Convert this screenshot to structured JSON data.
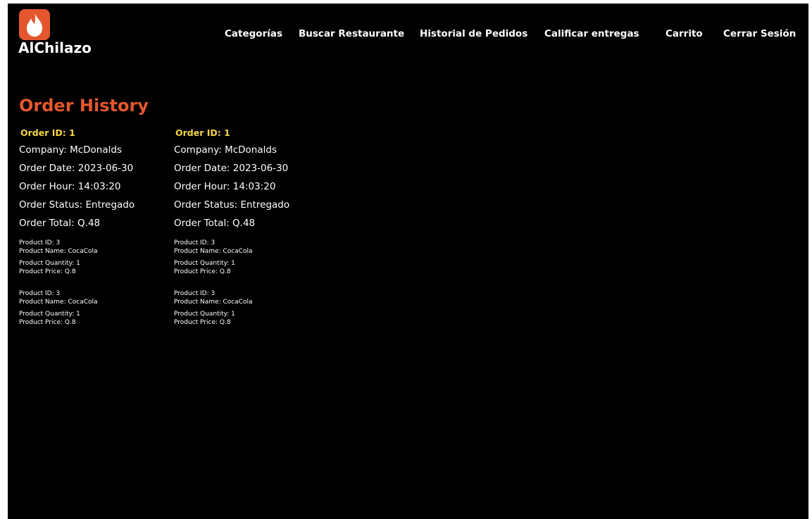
{
  "brand": {
    "name": "AlChilazo",
    "logo_icon": "flame-icon",
    "logo_color": "#e4572e"
  },
  "nav": {
    "items": [
      {
        "label": "Categorías"
      },
      {
        "label": "Buscar Restaurante"
      },
      {
        "label": "Historial de Pedidos"
      },
      {
        "label": "Calificar entregas"
      },
      {
        "label": "Carrito"
      },
      {
        "label": "Cerrar Sesión"
      }
    ]
  },
  "page": {
    "title": "Order History",
    "title_color": "#e4572e",
    "accent_color": "#f5d547"
  },
  "orders": [
    {
      "id": "Order ID: 1",
      "company": "Company: McDonalds",
      "date": "Order Date: 2023-06-30",
      "hour": "Order Hour: 14:03:20",
      "status": "Order Status: Entregado",
      "total": "Order Total: Q.48",
      "products": [
        {
          "id": "Product ID: 3",
          "name": "Product Name: CocaCola",
          "quantity": "Product Quantity: 1",
          "price": "Product Price: Q.8"
        },
        {
          "id": "Product ID: 3",
          "name": "Product Name: CocaCola",
          "quantity": "Product Quantity: 1",
          "price": "Product Price: Q.8"
        }
      ]
    },
    {
      "id": "Order ID: 1",
      "company": "Company: McDonalds",
      "date": "Order Date: 2023-06-30",
      "hour": "Order Hour: 14:03:20",
      "status": "Order Status: Entregado",
      "total": "Order Total: Q.48",
      "products": [
        {
          "id": "Product ID: 3",
          "name": "Product Name: CocaCola",
          "quantity": "Product Quantity: 1",
          "price": "Product Price: Q.8"
        },
        {
          "id": "Product ID: 3",
          "name": "Product Name: CocaCola",
          "quantity": "Product Quantity: 1",
          "price": "Product Price: Q.8"
        }
      ]
    }
  ]
}
